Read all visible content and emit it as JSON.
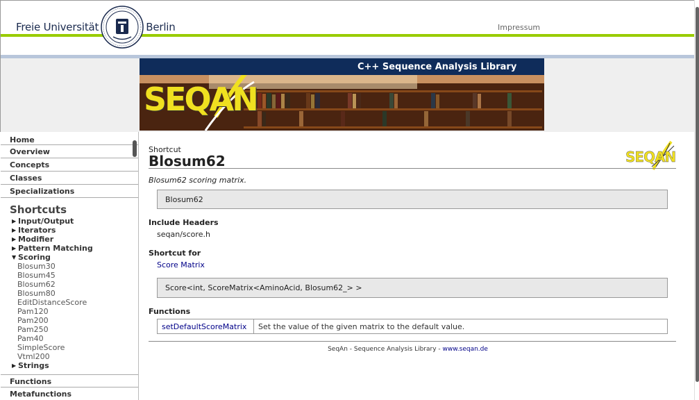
{
  "header": {
    "university_word_1": "Freie Universität",
    "university_word_2": "Berlin",
    "impressum": "Impressum"
  },
  "banner": {
    "title": "C++ Sequence Analysis Library",
    "logo_text": "SEQAN"
  },
  "sidebar": {
    "top_items": [
      {
        "label": "Home"
      },
      {
        "label": "Overview"
      },
      {
        "label": "Concepts"
      },
      {
        "label": "Classes"
      },
      {
        "label": "Specializations"
      }
    ],
    "shortcuts_heading": "Shortcuts",
    "tree": [
      {
        "label": "Input/Output",
        "expanded": false
      },
      {
        "label": "Iterators",
        "expanded": false
      },
      {
        "label": "Modifier",
        "expanded": false
      },
      {
        "label": "Pattern Matching",
        "expanded": false
      },
      {
        "label": "Scoring",
        "expanded": true
      }
    ],
    "scoring_children": [
      "Blosum30",
      "Blosum45",
      "Blosum62",
      "Blosum80",
      "EditDistanceScore",
      "Pam120",
      "Pam200",
      "Pam250",
      "Pam40",
      "SimpleScore",
      "Vtml200"
    ],
    "strings_item": {
      "label": "Strings",
      "expanded": false
    },
    "bottom_items": [
      {
        "label": "Functions"
      },
      {
        "label": "Metafunctions"
      }
    ]
  },
  "main": {
    "kind": "Shortcut",
    "title": "Blosum62",
    "brief": "Blosum62 scoring matrix.",
    "signature": "Blosum62",
    "include_heading": "Include Headers",
    "include_value": "seqan/score.h",
    "shortcut_for_heading": "Shortcut for",
    "shortcut_for_link": "Score Matrix",
    "definition": "Score<int, ScoreMatrix<AminoAcid, Blosum62_> >",
    "functions_heading": "Functions",
    "functions": [
      {
        "name": "setDefaultScoreMatrix",
        "description": "Set the value of the given matrix to the default value."
      }
    ],
    "small_logo_text": "SEQAN"
  },
  "footer": {
    "text": "SeqAn - Sequence Analysis Library - ",
    "link": "www.seqan.de"
  },
  "colors": {
    "green_line": "#99cc00",
    "blue_line": "#b8c6db",
    "banner_bar": "#0f2c5a",
    "link": "#000088",
    "logo_yellow": "#f0e020"
  }
}
